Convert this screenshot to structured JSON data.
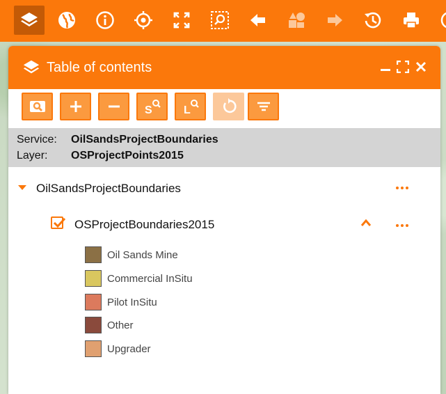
{
  "toolbar": {
    "tools": [
      {
        "name": "layers-tool-button",
        "icon": "layers-icon",
        "active": true
      },
      {
        "name": "basemap-tool-button",
        "icon": "globe-icon"
      },
      {
        "name": "info-tool-button",
        "icon": "info-icon"
      },
      {
        "name": "locate-tool-button",
        "icon": "crosshair-icon"
      },
      {
        "name": "full-extent-tool-button",
        "icon": "fullscreen-icon"
      },
      {
        "name": "zoom-selection-tool-button",
        "icon": "zoom-area-icon"
      },
      {
        "name": "previous-extent-tool-button",
        "icon": "arrow-left-icon"
      },
      {
        "name": "shapes-tool-button",
        "icon": "shapes-icon",
        "disabled": true
      },
      {
        "name": "next-extent-tool-button",
        "icon": "arrow-right-icon",
        "disabled": true
      },
      {
        "name": "history-tool-button",
        "icon": "history-icon"
      },
      {
        "name": "print-tool-button",
        "icon": "print-icon"
      },
      {
        "name": "language-tool-button",
        "icon": "globe-outline-icon"
      }
    ],
    "color": "#fb780b"
  },
  "panel": {
    "title": "Table of contents",
    "buttons": [
      {
        "name": "search-map-button",
        "icon": "search-map-icon"
      },
      {
        "name": "add-service-button",
        "icon": "plus-icon"
      },
      {
        "name": "remove-service-button",
        "icon": "minus-icon"
      },
      {
        "name": "service-search-button",
        "icon": "service-search-icon",
        "letter": "S"
      },
      {
        "name": "layer-search-button",
        "icon": "layer-search-icon",
        "letter": "L"
      },
      {
        "name": "refresh-button",
        "icon": "refresh-icon",
        "disabled": true
      },
      {
        "name": "filter-button",
        "icon": "filter-icon"
      }
    ],
    "service_label": "Service:",
    "service_value": "OilSandsProjectBoundaries",
    "layer_label": "Layer:",
    "layer_value": "OSProjectPoints2015"
  },
  "tree": {
    "service": "OilSandsProjectBoundaries",
    "layer": "OSProjectBoundaries2015",
    "layer_checked": true,
    "legend": [
      {
        "label": "Oil Sands Mine",
        "color": "#8b7045"
      },
      {
        "label": "Commercial InSitu",
        "color": "#d9c75f"
      },
      {
        "label": "Pilot InSitu",
        "color": "#dc7a5d"
      },
      {
        "label": "Other",
        "color": "#8a4a3c"
      },
      {
        "label": "Upgrader",
        "color": "#e0a070"
      }
    ]
  }
}
